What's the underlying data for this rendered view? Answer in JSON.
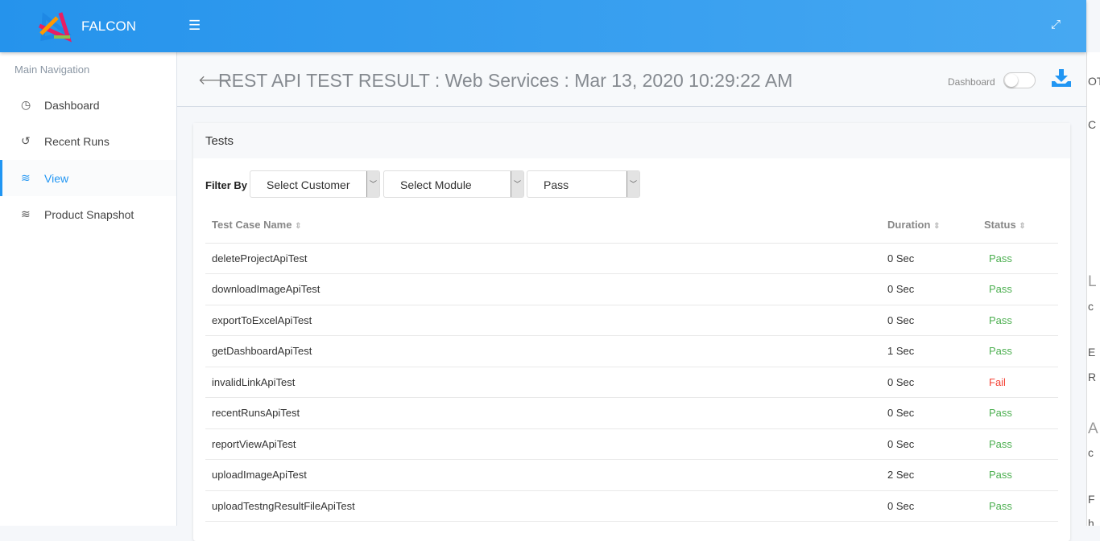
{
  "header": {
    "brand": "FALCON",
    "menu_icon": "hamburger-icon",
    "expand_icon": "expand-icon",
    "brand_color": "#2196f3"
  },
  "sidebar": {
    "heading": "Main Navigation",
    "items": [
      {
        "label": "Dashboard",
        "icon": "gauge-icon",
        "glyph": "◷"
      },
      {
        "label": "Recent Runs",
        "icon": "history-icon",
        "glyph": "↺"
      },
      {
        "label": "View",
        "icon": "layers-icon",
        "glyph": "≋",
        "active": true
      },
      {
        "label": "Product Snapshot",
        "icon": "layers-icon",
        "glyph": "≋"
      }
    ]
  },
  "page": {
    "title": "REST API TEST RESULT : Web Services : Mar 13, 2020 10:29:22 AM",
    "dashboard_toggle_label": "Dashboard",
    "dashboard_toggle_on": false
  },
  "card": {
    "title": "Tests",
    "filter_label": "Filter By",
    "filters": [
      "Select Customer",
      "Select Module",
      "Pass"
    ],
    "columns": [
      "Test Case Name",
      "Duration",
      "Status"
    ],
    "rows": [
      [
        "deleteProjectApiTest",
        "0 Sec",
        "Pass"
      ],
      [
        "downloadImageApiTest",
        "0 Sec",
        "Pass"
      ],
      [
        "exportToExcelApiTest",
        "0 Sec",
        "Pass"
      ],
      [
        "getDashboardApiTest",
        "1 Sec",
        "Pass"
      ],
      [
        "invalidLinkApiTest",
        "0 Sec",
        "Fail"
      ],
      [
        "recentRunsApiTest",
        "0 Sec",
        "Pass"
      ],
      [
        "reportViewApiTest",
        "0 Sec",
        "Pass"
      ],
      [
        "uploadImageApiTest",
        "2 Sec",
        "Pass"
      ],
      [
        "uploadTestngResultFileApiTest",
        "0 Sec",
        "Pass"
      ]
    ]
  },
  "right_panel": {
    "fragments": [
      "OT",
      "C",
      "L",
      "c",
      "E",
      "R",
      "A",
      "c",
      "F",
      "h"
    ]
  },
  "colors": {
    "pass": "#4caf50",
    "fail": "#f44336"
  }
}
